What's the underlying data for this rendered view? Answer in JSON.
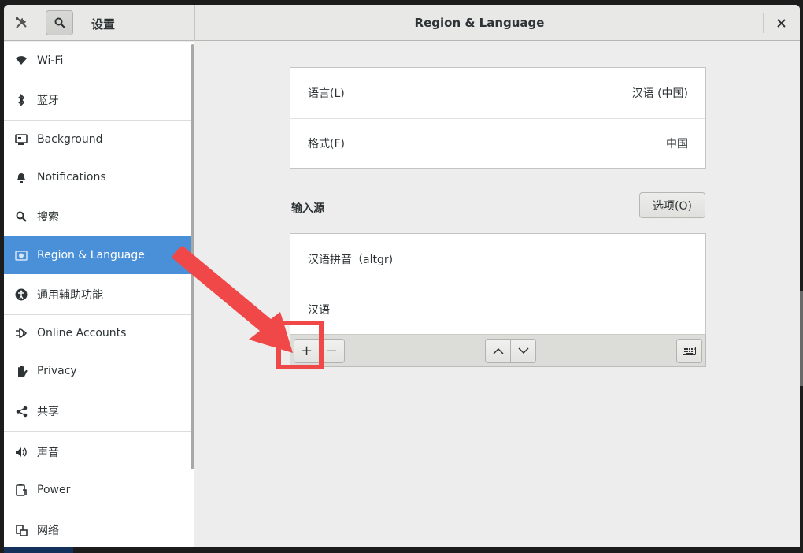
{
  "header": {
    "app_title": "设置",
    "panel_title": "Region & Language"
  },
  "sidebar": {
    "items": [
      {
        "label": "Wi-Fi",
        "icon": "wifi-icon"
      },
      {
        "label": "蓝牙",
        "icon": "bluetooth-icon"
      },
      {
        "label": "Background",
        "icon": "background-icon"
      },
      {
        "label": "Notifications",
        "icon": "bell-icon"
      },
      {
        "label": "搜索",
        "icon": "search-icon"
      },
      {
        "label": "Region & Language",
        "icon": "region-icon",
        "active": true
      },
      {
        "label": "通用辅助功能",
        "icon": "accessibility-icon"
      },
      {
        "label": "Online Accounts",
        "icon": "online-accounts-icon"
      },
      {
        "label": "Privacy",
        "icon": "hand-icon"
      },
      {
        "label": "共享",
        "icon": "share-icon"
      },
      {
        "label": "声音",
        "icon": "speaker-icon"
      },
      {
        "label": "Power",
        "icon": "power-icon"
      },
      {
        "label": "网络",
        "icon": "network-icon"
      }
    ]
  },
  "language_card": {
    "language_label": "语言(L)",
    "language_value": "汉语 (中国)",
    "formats_label": "格式(F)",
    "formats_value": "中国"
  },
  "input_sources": {
    "section_label": "输入源",
    "options_button": "选项(O)",
    "sources": [
      "汉语拼音（altgr)",
      "汉语"
    ],
    "add_label": "+",
    "remove_label": "−"
  },
  "colors": {
    "accent": "#4a90d9",
    "annotation": "#f04848"
  }
}
